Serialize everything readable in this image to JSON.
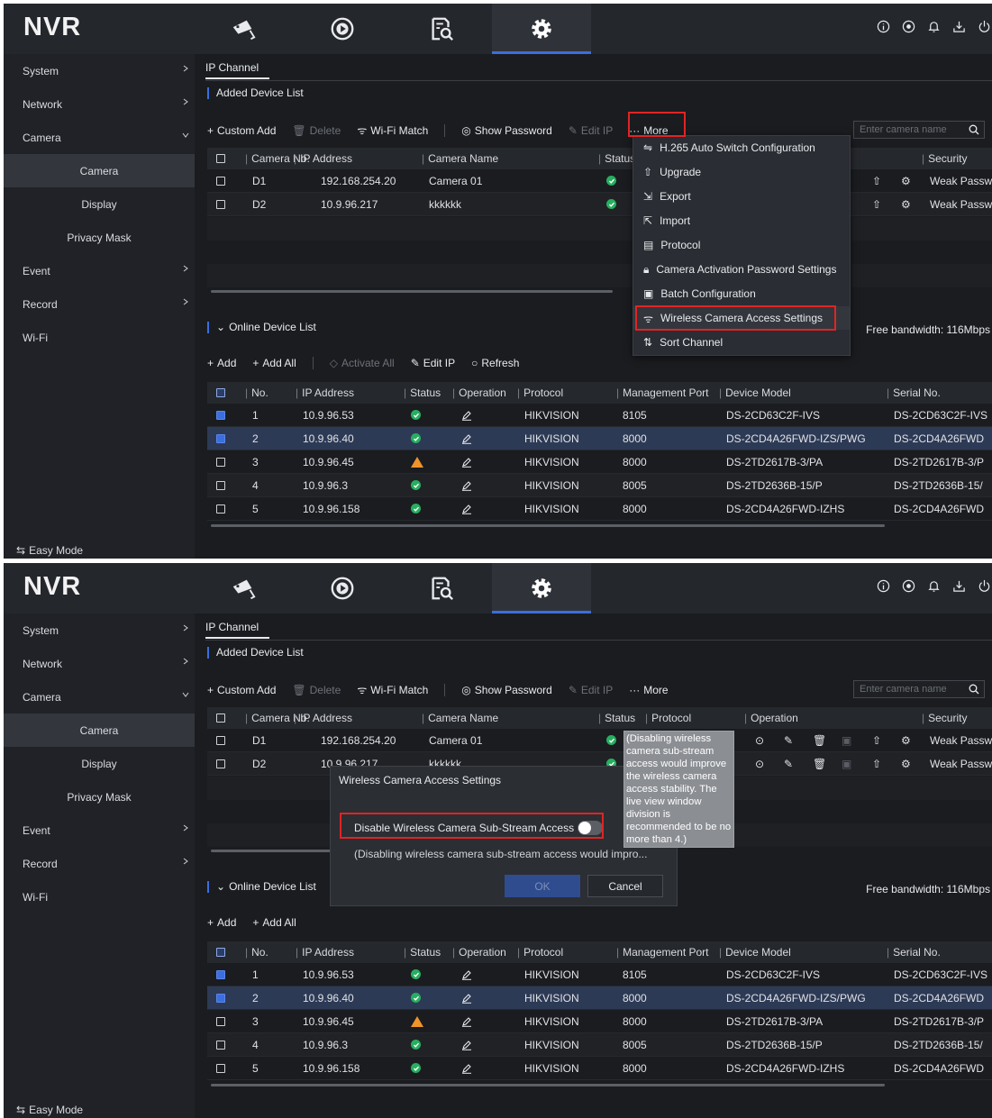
{
  "app": {
    "logo": "NVR"
  },
  "sidebar": {
    "items": [
      {
        "label": "System"
      },
      {
        "label": "Network"
      },
      {
        "label": "Camera"
      },
      {
        "label": "Camera"
      },
      {
        "label": "Display"
      },
      {
        "label": "Privacy Mask"
      },
      {
        "label": "Event"
      },
      {
        "label": "Record"
      },
      {
        "label": "Wi-Fi"
      }
    ],
    "easy_mode": "Easy Mode"
  },
  "content": {
    "tab": "IP Channel",
    "added_section": "Added Device List",
    "toolbar": {
      "custom_add": "Custom Add",
      "delete": "Delete",
      "wifi_match": "Wi-Fi Match",
      "show_password": "Show Password",
      "edit_ip": "Edit IP",
      "more": "More"
    },
    "search_placeholder": "Enter camera name",
    "added_headers": {
      "camera_no": "Camera No.",
      "ip_address": "IP Address",
      "camera_name": "Camera Name",
      "status": "Status",
      "status_trunc": "Status",
      "protocol": "Protocol",
      "operation": "Operation",
      "security": "Security"
    },
    "added_rows": [
      {
        "no": "D1",
        "ip": "192.168.254.20",
        "name": "Camera 01",
        "security": "Weak Passw"
      },
      {
        "no": "D2",
        "ip": "10.9.96.217",
        "name": "kkkkkk",
        "security": "Weak Passw"
      }
    ],
    "online_section": "Online Device List",
    "free_bandwidth": "Free bandwidth: 116Mbps",
    "online_toolbar": {
      "add": "Add",
      "add_all": "Add All",
      "activate_all": "Activate All",
      "edit_ip": "Edit IP",
      "refresh": "Refresh"
    },
    "online_headers": {
      "no": "No.",
      "ip": "IP Address",
      "status": "Status",
      "operation": "Operation",
      "protocol": "Protocol",
      "port": "Management Port",
      "model": "Device Model",
      "serial": "Serial No."
    },
    "online_rows": [
      {
        "no": "1",
        "ip": "10.9.96.53",
        "status": "ok",
        "protocol": "HIKVISION",
        "port": "8105",
        "model": "DS-2CD63C2F-IVS",
        "serial": "DS-2CD63C2F-IVS"
      },
      {
        "no": "2",
        "ip": "10.9.96.40",
        "status": "ok",
        "protocol": "HIKVISION",
        "port": "8000",
        "model": "DS-2CD4A26FWD-IZS/PWG",
        "serial": "DS-2CD4A26FWD"
      },
      {
        "no": "3",
        "ip": "10.9.96.45",
        "status": "warn",
        "protocol": "HIKVISION",
        "port": "8000",
        "model": "DS-2TD2617B-3/PA",
        "serial": "DS-2TD2617B-3/P"
      },
      {
        "no": "4",
        "ip": "10.9.96.3",
        "status": "ok",
        "protocol": "HIKVISION",
        "port": "8005",
        "model": "DS-2TD2636B-15/P",
        "serial": "DS-2TD2636B-15/"
      },
      {
        "no": "5",
        "ip": "10.9.96.158",
        "status": "ok",
        "protocol": "HIKVISION",
        "port": "8000",
        "model": "DS-2CD4A26FWD-IZHS",
        "serial": "DS-2CD4A26FWD"
      }
    ]
  },
  "more_menu": {
    "items": [
      {
        "label": "H.265 Auto Switch Configuration",
        "icon": "switch-icon"
      },
      {
        "label": "Upgrade",
        "icon": "upgrade-icon"
      },
      {
        "label": "Export",
        "icon": "export-icon"
      },
      {
        "label": "Import",
        "icon": "import-icon"
      },
      {
        "label": "Protocol",
        "icon": "protocol-icon"
      },
      {
        "label": "Camera Activation Password Settings",
        "icon": "lock-icon"
      },
      {
        "label": "Batch Configuration",
        "icon": "batch-icon"
      },
      {
        "label": "Wireless Camera Access Settings",
        "icon": "wireless-icon"
      },
      {
        "label": "Sort Channel",
        "icon": "sort-icon"
      }
    ]
  },
  "modal": {
    "title": "Wireless Camera Access Settings",
    "toggle_label": "Disable Wireless Camera Sub-Stream Access",
    "note": "(Disabling wireless camera sub-stream access would impro...",
    "ok": "OK",
    "cancel": "Cancel"
  },
  "tooltip": {
    "text": "(Disabling wireless camera sub-stream access would improve the wireless camera access stability. The live view window division is recommended to be no more than 4.)"
  },
  "colors": {
    "accent": "#3b6ede",
    "highlight": "#e02424",
    "ok": "#27ae60",
    "warn": "#f0932b"
  }
}
